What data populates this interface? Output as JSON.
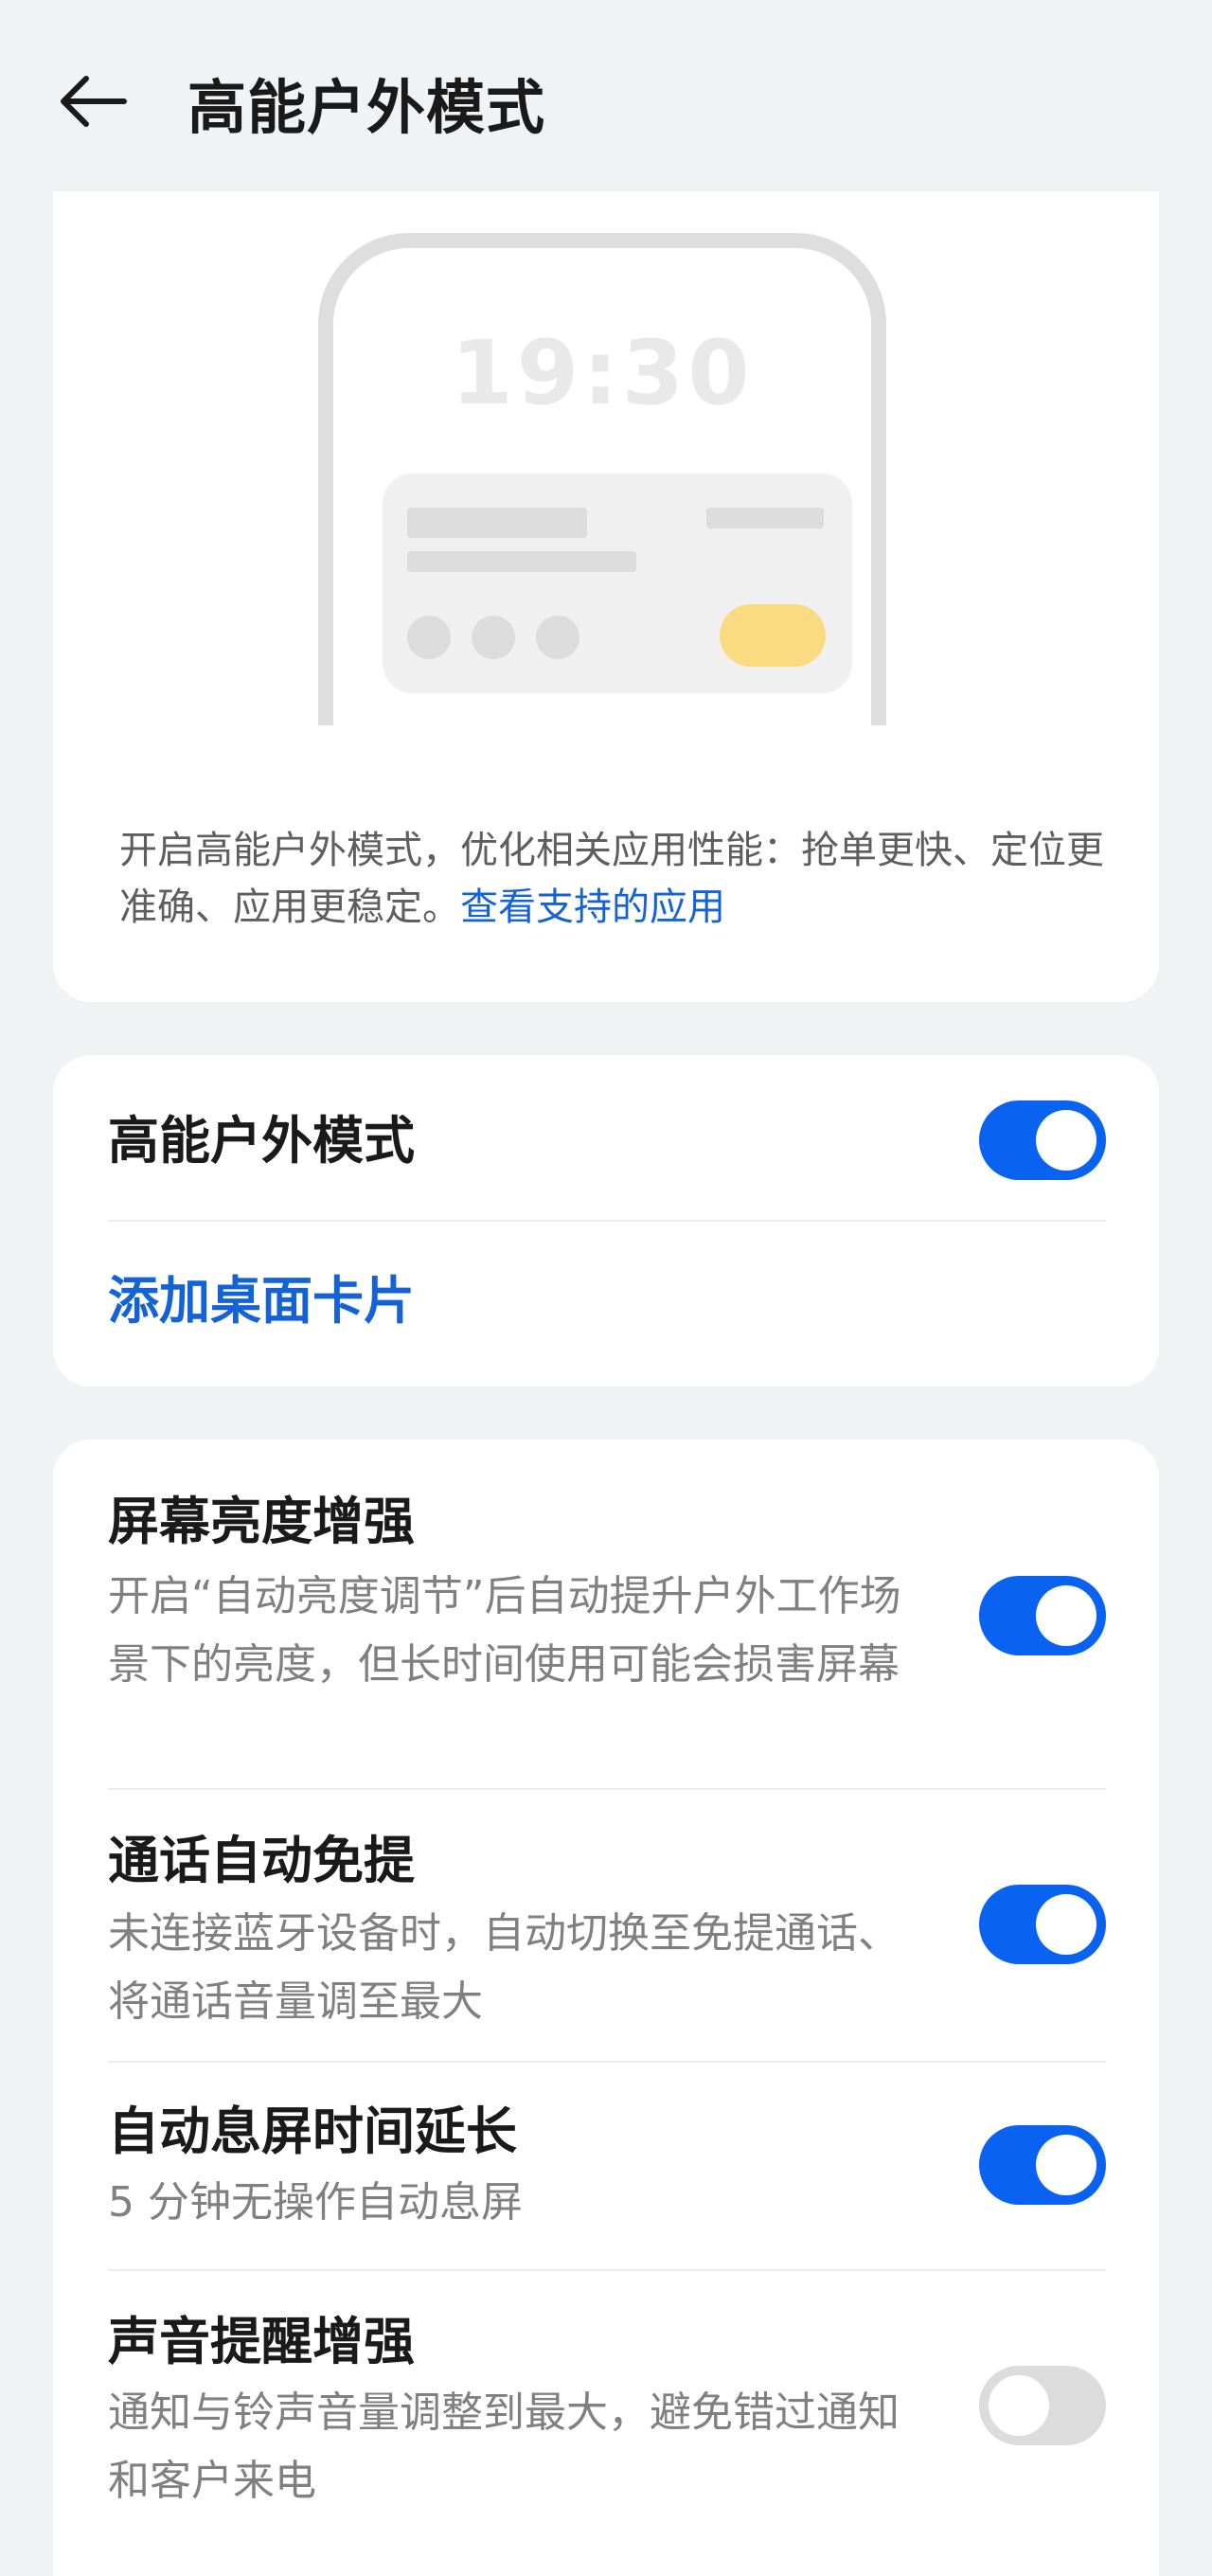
{
  "header": {
    "title": "高能户外模式",
    "back_icon": "arrow-left-icon"
  },
  "illustration": {
    "clock": "19:30",
    "accent_color": "#f9dc82"
  },
  "intro": {
    "description": "开启高能户外模式，优化相关应用性能：抢单更快、定位更准确、应用更稳定。",
    "link": "查看支持的应用"
  },
  "main_toggle": {
    "label": "高能户外模式",
    "enabled": true,
    "add_card_link": "添加桌面卡片"
  },
  "settings": [
    {
      "title": "屏幕亮度增强",
      "description": "开启“自动亮度调节”后自动提升户外工作场景下的亮度，但长时间使用可能会损害屏幕",
      "enabled": true
    },
    {
      "title": "通话自动免提",
      "description": "未连接蓝牙设备时，自动切换至免提通话、将通话音量调至最大",
      "enabled": true
    },
    {
      "title": "自动息屏时间延长",
      "description": "5 分钟无操作自动息屏",
      "enabled": true
    },
    {
      "title": "声音提醒增强",
      "description": "通知与铃声音量调整到最大，避免错过通知和客户来电",
      "enabled": false
    }
  ],
  "colors": {
    "accent": "#0a63f0",
    "link": "#1463d6",
    "background": "#f1f2f4"
  }
}
